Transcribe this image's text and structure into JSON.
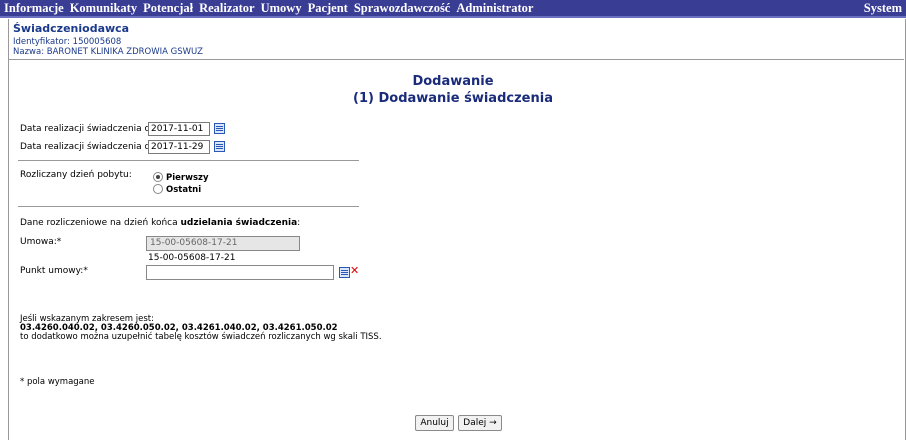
{
  "menu": {
    "items": [
      "Informacje",
      "Komunikaty",
      "Potencjał",
      "Realizator",
      "Umowy",
      "Pacjent",
      "Sprawozdawczość",
      "Administrator"
    ],
    "right_label": "System"
  },
  "provider": {
    "title": "Świadczeniodawca",
    "identifier": "Identyfikator: 150005608",
    "name": "Nazwa: BARONET KLINIKA ZDROWIA GSWUZ"
  },
  "heading": {
    "line1": "Dodawanie",
    "line2": "(1) Dodawanie świadczenia"
  },
  "dates": {
    "from_label": "Data realizacji świadczenia od:*",
    "from_value": "2017-11-01",
    "to_label": "Data realizacji świadczenia do:*",
    "to_value": "2017-11-29"
  },
  "stay_day": {
    "label": "Rozliczany dzień pobytu:",
    "options": [
      "Pierwszy",
      "Ostatni"
    ],
    "selected": "Pierwszy"
  },
  "billing": {
    "intro_prefix": "Dane rozliczeniowe na dzień końca ",
    "intro_bold": "udzielania świadczenia",
    "intro_suffix": ":",
    "contract_label": "Umowa:*",
    "contract_value": "15-00-05608-17-21",
    "contract_text": "15-00-05608-17-21",
    "point_label": "Punkt umowy:*",
    "point_value": ""
  },
  "info": {
    "line1": "Jeśli wskazanym zakresem jest:",
    "line2": "03.4260.040.02, 03.4260.050.02, 03.4261.040.02, 03.4261.050.02",
    "line3": "to dodatkowo można uzupełnić tabelę kosztów świadczeń rozliczanych wg skali TISS."
  },
  "required_note": "* pola wymagane",
  "buttons": {
    "cancel": "Anuluj",
    "next": "Dalej →"
  }
}
